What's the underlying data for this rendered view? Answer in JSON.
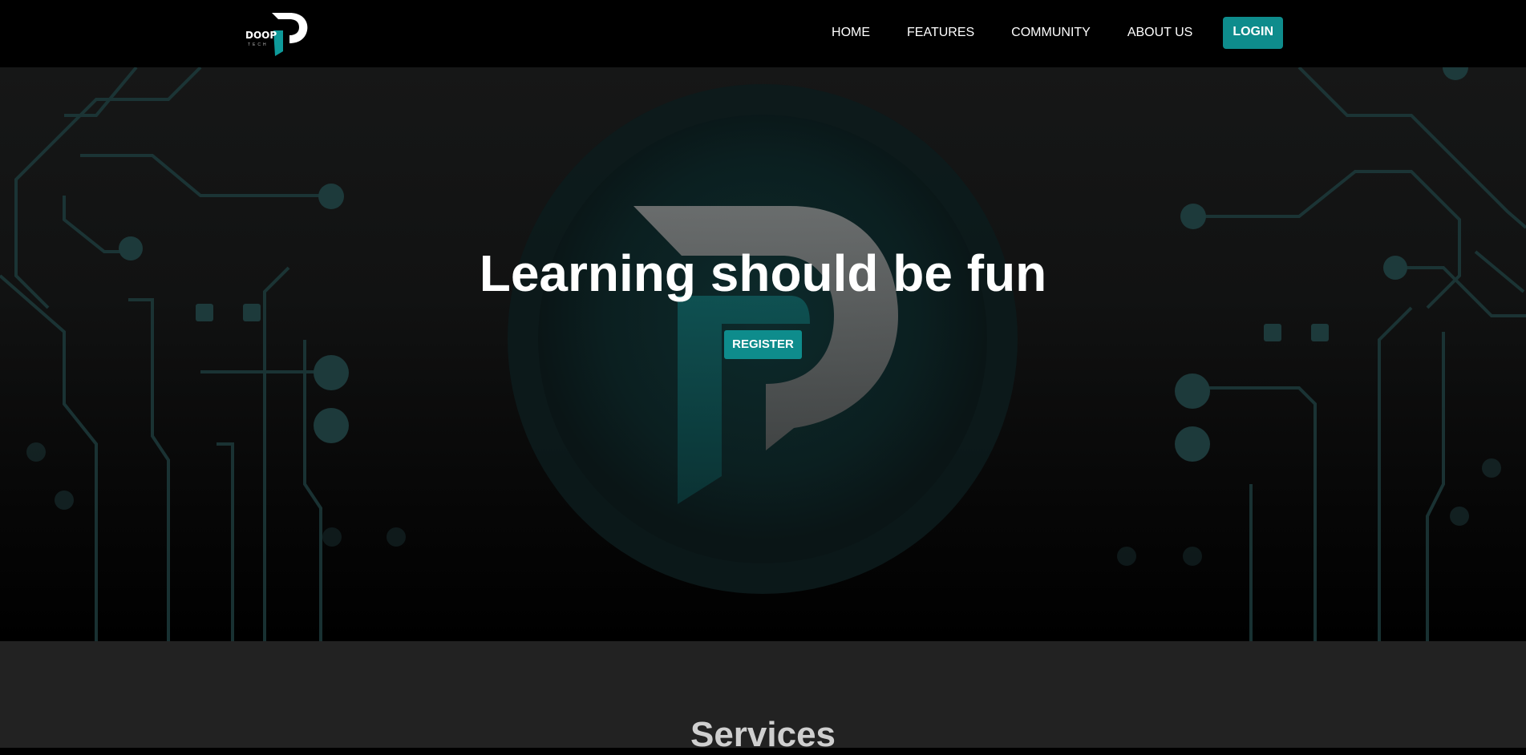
{
  "brand": {
    "logo_text": "DOOP",
    "logo_sub": "TECH",
    "accent_color": "#0e8c8c"
  },
  "nav": {
    "items": [
      {
        "label": "HOME"
      },
      {
        "label": "FEATURES"
      },
      {
        "label": "COMMUNITY"
      },
      {
        "label": "ABOUT US"
      }
    ],
    "login_label": "LOGIN"
  },
  "hero": {
    "title": "Learning should be fun",
    "register_label": "REGISTER",
    "background_icon": "doop-p-logo-watermark"
  },
  "services": {
    "title": "Services"
  }
}
